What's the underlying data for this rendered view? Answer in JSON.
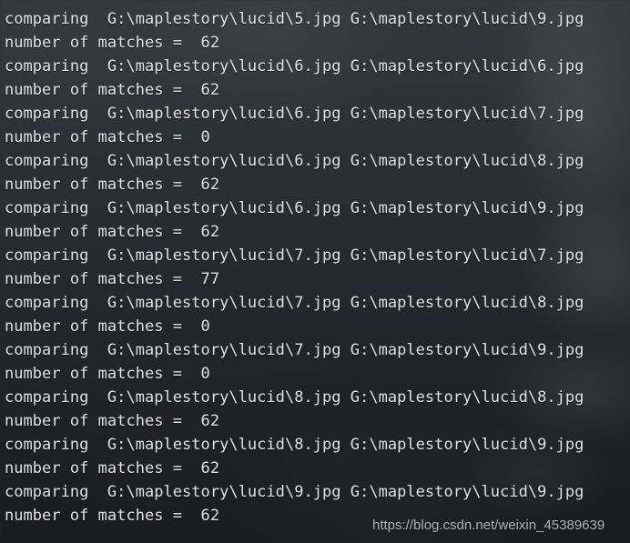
{
  "terminal": {
    "background_color": "#33383e",
    "text_color": "#dfe3e7",
    "lines": [
      "comparing  G:\\maplestory\\lucid\\5.jpg G:\\maplestory\\lucid\\9.jpg",
      "number of matches =  62",
      "comparing  G:\\maplestory\\lucid\\6.jpg G:\\maplestory\\lucid\\6.jpg",
      "number of matches =  62",
      "comparing  G:\\maplestory\\lucid\\6.jpg G:\\maplestory\\lucid\\7.jpg",
      "number of matches =  0",
      "comparing  G:\\maplestory\\lucid\\6.jpg G:\\maplestory\\lucid\\8.jpg",
      "number of matches =  62",
      "comparing  G:\\maplestory\\lucid\\6.jpg G:\\maplestory\\lucid\\9.jpg",
      "number of matches =  62",
      "comparing  G:\\maplestory\\lucid\\7.jpg G:\\maplestory\\lucid\\7.jpg",
      "number of matches =  77",
      "comparing  G:\\maplestory\\lucid\\7.jpg G:\\maplestory\\lucid\\8.jpg",
      "number of matches =  0",
      "comparing  G:\\maplestory\\lucid\\7.jpg G:\\maplestory\\lucid\\9.jpg",
      "number of matches =  0",
      "comparing  G:\\maplestory\\lucid\\8.jpg G:\\maplestory\\lucid\\8.jpg",
      "number of matches =  62",
      "comparing  G:\\maplestory\\lucid\\8.jpg G:\\maplestory\\lucid\\9.jpg",
      "number of matches =  62",
      "comparing  G:\\maplestory\\lucid\\9.jpg G:\\maplestory\\lucid\\9.jpg",
      "number of matches =  62"
    ],
    "comparisons": [
      {
        "image_a": "G:\\maplestory\\lucid\\5.jpg",
        "image_b": "G:\\maplestory\\lucid\\9.jpg",
        "matches": 62
      },
      {
        "image_a": "G:\\maplestory\\lucid\\6.jpg",
        "image_b": "G:\\maplestory\\lucid\\6.jpg",
        "matches": 62
      },
      {
        "image_a": "G:\\maplestory\\lucid\\6.jpg",
        "image_b": "G:\\maplestory\\lucid\\7.jpg",
        "matches": 0
      },
      {
        "image_a": "G:\\maplestory\\lucid\\6.jpg",
        "image_b": "G:\\maplestory\\lucid\\8.jpg",
        "matches": 62
      },
      {
        "image_a": "G:\\maplestory\\lucid\\6.jpg",
        "image_b": "G:\\maplestory\\lucid\\9.jpg",
        "matches": 62
      },
      {
        "image_a": "G:\\maplestory\\lucid\\7.jpg",
        "image_b": "G:\\maplestory\\lucid\\7.jpg",
        "matches": 77
      },
      {
        "image_a": "G:\\maplestory\\lucid\\7.jpg",
        "image_b": "G:\\maplestory\\lucid\\8.jpg",
        "matches": 0
      },
      {
        "image_a": "G:\\maplestory\\lucid\\7.jpg",
        "image_b": "G:\\maplestory\\lucid\\9.jpg",
        "matches": 0
      },
      {
        "image_a": "G:\\maplestory\\lucid\\8.jpg",
        "image_b": "G:\\maplestory\\lucid\\8.jpg",
        "matches": 62
      },
      {
        "image_a": "G:\\maplestory\\lucid\\8.jpg",
        "image_b": "G:\\maplestory\\lucid\\9.jpg",
        "matches": 62
      },
      {
        "image_a": "G:\\maplestory\\lucid\\9.jpg",
        "image_b": "G:\\maplestory\\lucid\\9.jpg",
        "matches": 62
      }
    ]
  },
  "watermark": {
    "text": "https://blog.csdn.net/weixin_45389639",
    "color": "#c4c8cc"
  }
}
